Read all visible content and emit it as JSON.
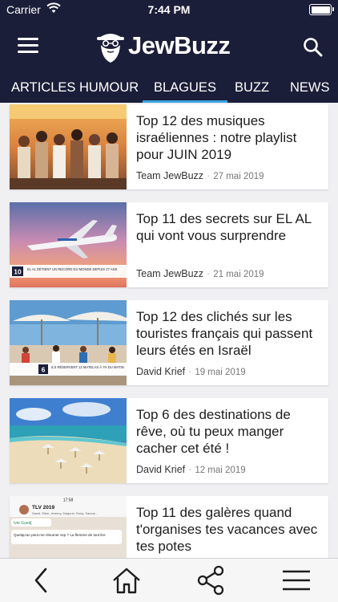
{
  "status_bar": {
    "carrier": "Carrier",
    "time": "7:44 PM"
  },
  "header": {
    "logo_text": "JewBuzz",
    "menu_icon": "hamburger-icon",
    "search_icon": "search-icon"
  },
  "tabs": [
    {
      "label": "ARTICLES HUMOUR",
      "active": false
    },
    {
      "label": "BLAGUES",
      "active": true
    },
    {
      "label": "BUZZ",
      "active": false
    },
    {
      "label": "NEWS",
      "active": false
    }
  ],
  "articles": [
    {
      "title": "Top 12 des musiques israéliennes : notre playlist pour JUIN 2019",
      "author": "Team JewBuzz",
      "date": "27 mai 2019"
    },
    {
      "title": "Top 11 des secrets sur EL AL qui vont vous surprendre",
      "author": "Team JewBuzz",
      "date": "21 mai 2019",
      "thumb_badge_num": "10",
      "thumb_badge_text": "EL AL DÉTIENT UN RECORD DU MONDE DEPUIS 27 ANS"
    },
    {
      "title": "Top 12 des clichés sur les touristes français qui passent leurs étés en Israël",
      "author": "David Krief",
      "date": "19 mai 2019",
      "thumb_badge_num": "6",
      "thumb_badge_text": "ILS RÉSERVENT 12 MATELAS À 7H DU MATIN"
    },
    {
      "title": "Top 6 des destinations de rêve, où tu peux manger cacher cet été !",
      "author": "David Krief",
      "date": "12 mai 2019"
    },
    {
      "title": "Top 11 des galères quand t'organises tes vacances avec tes potes",
      "author": "",
      "date": "",
      "thumb_time": "17:58",
      "thumb_group": "TLV 2019",
      "thumb_members": "David, Elkin, Jérémy, Marjorie, Rudy, Samue...",
      "thumb_sender": "Ivie Guedj",
      "thumb_message": "Quelqu'un peut me résumer svp ? La flemme de tout lire"
    }
  ],
  "toolbar": {
    "back_icon": "back-arrow-icon",
    "home_icon": "home-icon",
    "share_icon": "share-icon",
    "menu_icon": "menu-lines-icon"
  },
  "colors": {
    "header_bg": "#1b1e38",
    "tab_indicator": "#3aa3e3",
    "feed_bg": "#f0f0f3"
  }
}
